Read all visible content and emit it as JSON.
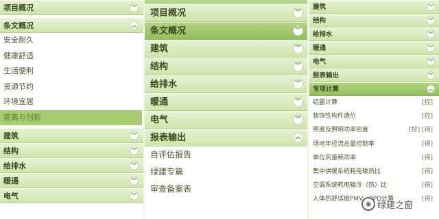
{
  "panel1": {
    "header_project": "项目概况",
    "header_clauses": "条文概况",
    "clause_items": [
      "安全耐久",
      "健康舒适",
      "生活便利",
      "资源节约",
      "环境宜居",
      "提高与创新"
    ],
    "sections": [
      "建筑",
      "结构",
      "给排水",
      "暖通",
      "电气"
    ]
  },
  "panel2": {
    "header_project": "项目概况",
    "header_clauses": "条文概况",
    "sections": [
      "建筑",
      "结构",
      "给排水",
      "暖通",
      "电气"
    ],
    "header_report": "报表输出",
    "report_items": [
      "自评估报告",
      "绿建专篇",
      "审查备案表"
    ]
  },
  "panel3": {
    "sections": [
      "建筑",
      "结构",
      "给排水",
      "暖通",
      "电气",
      "报表输出"
    ],
    "header_calc": "专项计算",
    "calc_items": [
      {
        "label": "结露计算",
        "tag": "[控]"
      },
      {
        "label": "装饰性构件造价",
        "tag": "[控]"
      },
      {
        "label": "照度及照明功率密度",
        "tag": "[控] [得]"
      },
      {
        "label": "场地年径流总量控制率",
        "tag": "[得]"
      },
      {
        "label": "单位风量耗功率",
        "tag": "[得]"
      },
      {
        "label": "集中供暖系统耗电输热比",
        "tag": "[得]"
      },
      {
        "label": "空调系统耗电输冷（热）比",
        "tag": "[得]"
      },
      {
        "label": "人体热舒适度PMV、PPD计算",
        "tag": "[得]"
      }
    ]
  },
  "icons": {
    "expand": "chevron-down-icon",
    "collapse": "chevron-up-icon"
  },
  "watermark": "绿建之窗",
  "colors": {
    "header": "#cfe5ad",
    "header_active": "#93bf5c",
    "highlight": "#a8cc70"
  }
}
